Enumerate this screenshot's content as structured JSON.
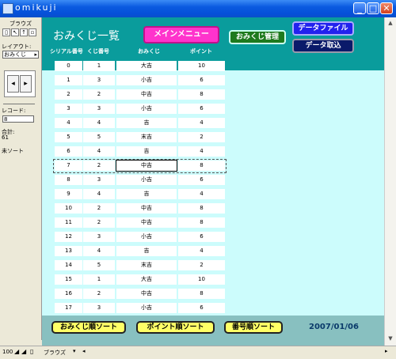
{
  "window": {
    "title": "omikuji"
  },
  "left_panel": {
    "mode": "ブラウズ",
    "layout_label": "レイアウト:",
    "layout_value": "おみくじ",
    "record_label": "レコード:",
    "record_value": "8",
    "total_label": "合計:",
    "total_value": "61",
    "sort_status": "未ソート"
  },
  "header": {
    "title": "おみくじ一覧",
    "main_menu": "メインメニュー",
    "omikuji_manage": "おみくじ管理",
    "data_file": "データファイル",
    "data_import": "データ取込",
    "columns": [
      "シリアル番号",
      "くじ番号",
      "おみくじ",
      "ポイント"
    ]
  },
  "records": [
    [
      "0",
      "1",
      "大吉",
      "10"
    ],
    [
      "1",
      "3",
      "小吉",
      "6"
    ],
    [
      "2",
      "2",
      "中吉",
      "8"
    ],
    [
      "3",
      "3",
      "小吉",
      "6"
    ],
    [
      "4",
      "4",
      "吉",
      "4"
    ],
    [
      "5",
      "5",
      "末吉",
      "2"
    ],
    [
      "6",
      "4",
      "吉",
      "4"
    ],
    [
      "7",
      "2",
      "中吉",
      "8"
    ],
    [
      "8",
      "3",
      "小吉",
      "6"
    ],
    [
      "9",
      "4",
      "吉",
      "4"
    ],
    [
      "10",
      "2",
      "中吉",
      "8"
    ],
    [
      "11",
      "2",
      "中吉",
      "8"
    ],
    [
      "12",
      "3",
      "小吉",
      "6"
    ],
    [
      "13",
      "4",
      "吉",
      "4"
    ],
    [
      "14",
      "5",
      "末吉",
      "2"
    ],
    [
      "15",
      "1",
      "大吉",
      "10"
    ],
    [
      "16",
      "2",
      "中吉",
      "8"
    ],
    [
      "17",
      "3",
      "小吉",
      "6"
    ]
  ],
  "selected_index": 7,
  "footer": {
    "sort_omikuji": "おみくじ順ソート",
    "sort_point": "ポイント順ソート",
    "sort_number": "番号順ソート",
    "date": "2007/01/06"
  },
  "statusbar": {
    "zoom": "100",
    "mode": "ブラウズ"
  }
}
